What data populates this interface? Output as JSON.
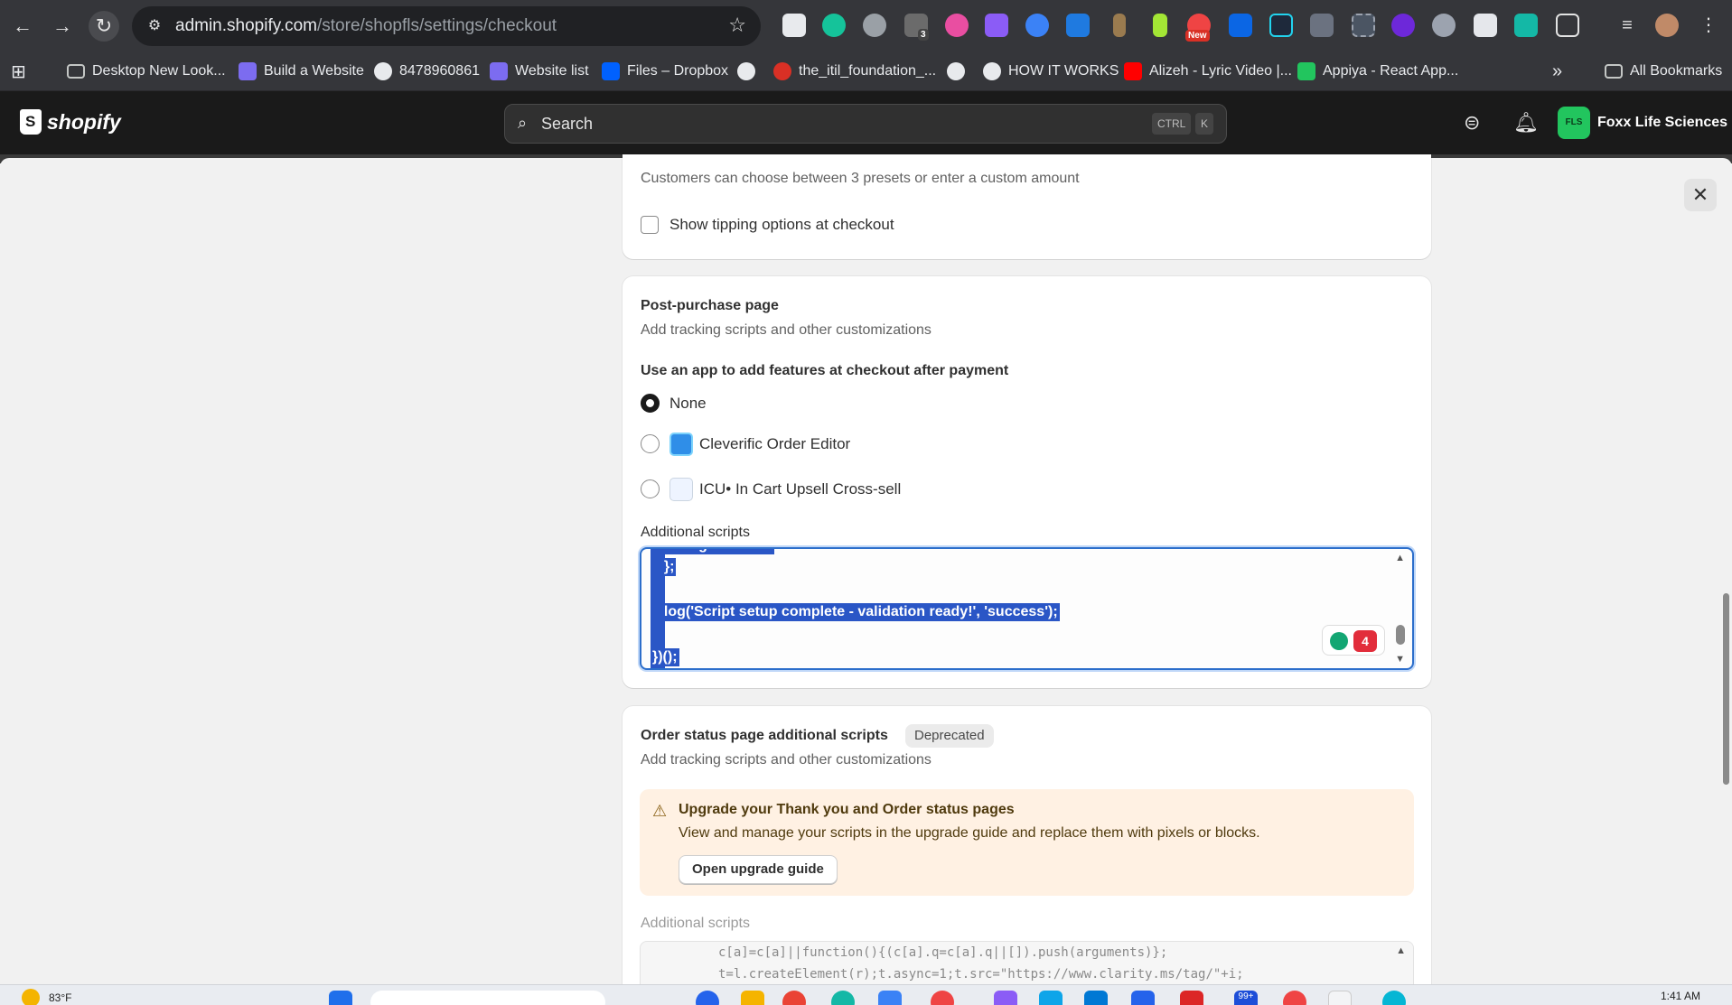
{
  "browser": {
    "url_host": "admin.shopify.com",
    "url_path": "/store/shopfls/settings/checkout",
    "extension_count_badge": "3",
    "extension_new_badge": "New",
    "bookmarks": [
      {
        "label": "Desktop New Look..."
      },
      {
        "label": "Build a Website"
      },
      {
        "label": "8478960861"
      },
      {
        "label": "Website list"
      },
      {
        "label": "Files – Dropbox"
      },
      {
        "label": ""
      },
      {
        "label": "the_itil_foundation_..."
      },
      {
        "label": ""
      },
      {
        "label": "HOW IT WORKS"
      },
      {
        "label": "Alizeh - Lyric Video |..."
      },
      {
        "label": "Appiya - React App..."
      }
    ],
    "more_bookmarks": "»",
    "all_bookmarks": "All Bookmarks"
  },
  "topbar": {
    "logo_text": "shopify",
    "search_placeholder": "Search",
    "shortcut_ctrl": "CTRL",
    "shortcut_k": "K",
    "store_initials": "FLS",
    "store_name": "Foxx Life Sciences"
  },
  "tipping": {
    "subtitle": "Customers can choose between 3 presets or enter a custom amount",
    "checkbox_label": "Show tipping options at checkout",
    "checked": false
  },
  "post_purchase": {
    "title": "Post-purchase page",
    "subtitle": "Add tracking scripts and other customizations",
    "question": "Use an app to add features at checkout after payment",
    "options": [
      {
        "label": "None",
        "selected": true
      },
      {
        "label": "Cleverific Order Editor",
        "selected": false
      },
      {
        "label": "ICU• In Cart Upsell Cross-sell",
        "selected": false
      }
    ],
    "scripts_label": "Additional scripts",
    "code_lines": [
      "  config: CONFIG",
      "  };",
      "",
      "  log('Script setup complete - validation ready!', 'success');",
      "",
      "})();"
    ],
    "grammarly_count": "4"
  },
  "order_status": {
    "title": "Order status page additional scripts",
    "badge": "Deprecated",
    "subtitle": "Add tracking scripts and other customizations",
    "banner_title": "Upgrade your Thank you and Order status pages",
    "banner_text": "View and manage your scripts in the upgrade guide and replace them with pixels or blocks.",
    "banner_button": "Open upgrade guide",
    "scripts_label": "Additional scripts",
    "code_lines": [
      "c[a]=c[a]||function(){(c[a].q=c[a].q||[]).push(arguments)};",
      "t=l.createElement(r);t.async=1;t.src=\"https://www.clarity.ms/tag/\"+i;"
    ]
  },
  "taskbar": {
    "weather": "83°F",
    "time": "1:41 AM",
    "badge_count": "99+"
  },
  "colors": {
    "accent": "#2c6ecb",
    "selection": "#2a56c6",
    "warning_bg": "#fff1e3",
    "store_avatar": "#22c55e"
  }
}
